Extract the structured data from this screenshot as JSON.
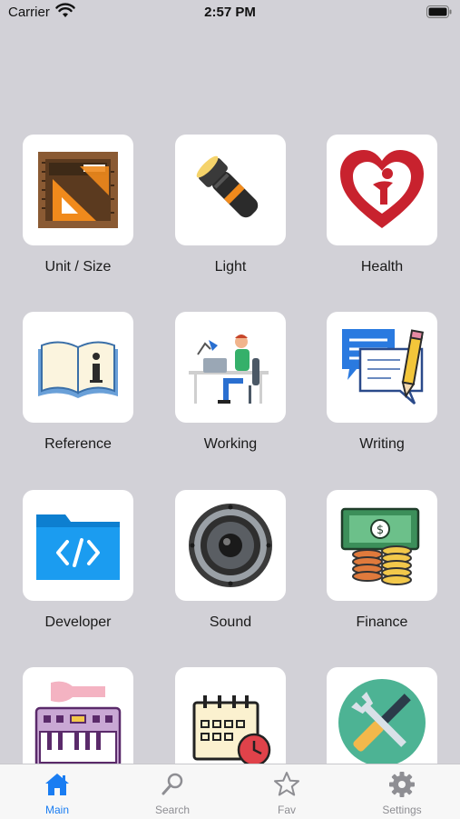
{
  "status_bar": {
    "carrier": "Carrier",
    "time": "2:57 PM"
  },
  "grid": {
    "items": [
      {
        "label": "Unit / Size",
        "icon": "ruler-set-icon"
      },
      {
        "label": "Light",
        "icon": "flashlight-icon"
      },
      {
        "label": "Health",
        "icon": "heart-person-icon"
      },
      {
        "label": "Reference",
        "icon": "info-book-icon"
      },
      {
        "label": "Working",
        "icon": "person-at-desk-icon"
      },
      {
        "label": "Writing",
        "icon": "note-pencil-icon"
      },
      {
        "label": "Developer",
        "icon": "code-folder-icon"
      },
      {
        "label": "Sound",
        "icon": "speaker-icon"
      },
      {
        "label": "Finance",
        "icon": "money-coins-icon"
      },
      {
        "label": "",
        "icon": "keyboard-guitar-icon"
      },
      {
        "label": "",
        "icon": "calendar-clock-icon"
      },
      {
        "label": "",
        "icon": "tools-icon"
      }
    ]
  },
  "tab_bar": {
    "tabs": [
      {
        "label": "Main",
        "icon": "home-icon",
        "active": true
      },
      {
        "label": "Search",
        "icon": "search-icon",
        "active": false
      },
      {
        "label": "Fav",
        "icon": "star-icon",
        "active": false
      },
      {
        "label": "Settings",
        "icon": "gear-icon",
        "active": false
      }
    ]
  },
  "colors": {
    "background": "#d2d1d7",
    "accent": "#1a7df2",
    "inactive": "#8e8e93"
  }
}
